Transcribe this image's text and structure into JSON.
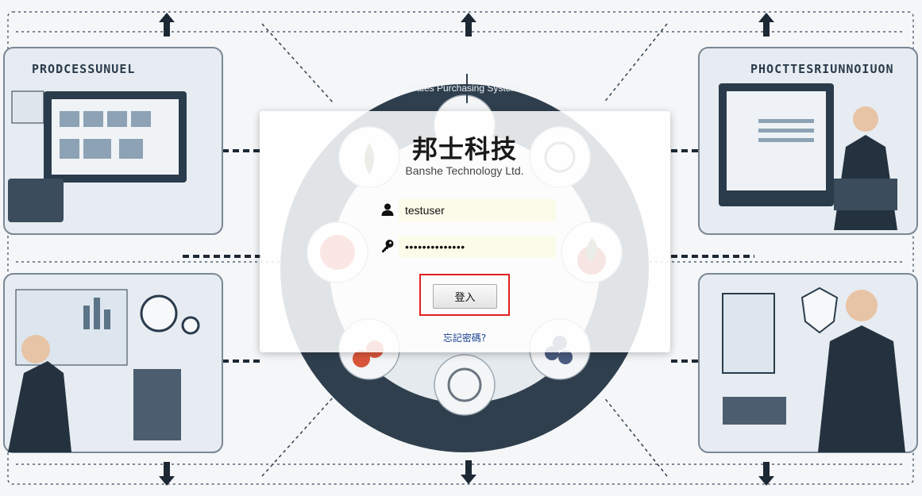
{
  "background": {
    "left_panel_title": "PRODCESSUNUEL",
    "right_panel_title": "PHOCTTESRIUNNOIUON",
    "system_title": "Sales Purchasing System"
  },
  "logo": {
    "name_cn": "邦士科技",
    "name_en": "Banshe Technology Ltd."
  },
  "login": {
    "username_value": "testuser",
    "password_value": "••••••••••••••",
    "submit_label": "登入",
    "forgot_label": "忘記密碼?"
  },
  "colors": {
    "highlight": "#e02020",
    "input_bg": "#fbfbe9",
    "center_disc": "#2f3f4e"
  },
  "icons": {
    "user": "user-icon",
    "password": "key-icon"
  }
}
